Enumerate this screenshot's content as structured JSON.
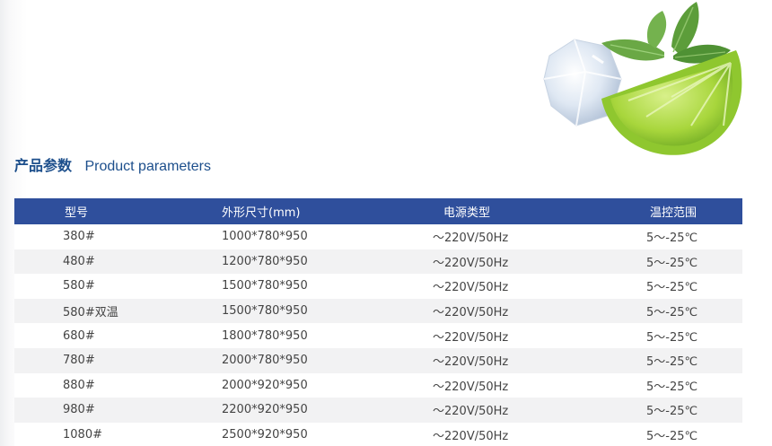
{
  "section": {
    "title_zh": "产品参数",
    "title_en": "Product parameters"
  },
  "colors": {
    "header_bg": "#2f4f9c",
    "title": "#1d4f8c",
    "stripe": "#f2f2f3"
  },
  "decoration": {
    "icons": [
      "ice-cube-icon",
      "lime-slice-icon",
      "mint-leaf-icon"
    ]
  },
  "table": {
    "headers": [
      "型号",
      "外形尺寸(mm)",
      "电源类型",
      "温控范围"
    ],
    "rows": [
      [
        "380#",
        "1000*780*950",
        "～220V/50Hz",
        "5～-25℃"
      ],
      [
        "480#",
        "1200*780*950",
        "～220V/50Hz",
        "5～-25℃"
      ],
      [
        "580#",
        "1500*780*950",
        "～220V/50Hz",
        "5～-25℃"
      ],
      [
        "580#双温",
        "1500*780*950",
        "～220V/50Hz",
        "5～-25℃"
      ],
      [
        "680#",
        "1800*780*950",
        "～220V/50Hz",
        "5～-25℃"
      ],
      [
        "780#",
        "2000*780*950",
        "～220V/50Hz",
        "5～-25℃"
      ],
      [
        "880#",
        "2000*920*950",
        "～220V/50Hz",
        "5～-25℃"
      ],
      [
        "980#",
        "2200*920*950",
        "～220V/50Hz",
        "5～-25℃"
      ],
      [
        "1080#",
        "2500*920*950",
        "～220V/50Hz",
        "5～-25℃"
      ]
    ]
  }
}
